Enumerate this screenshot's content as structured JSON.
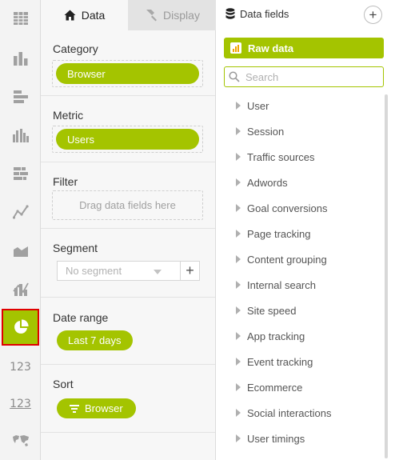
{
  "rail": {
    "items": [
      {
        "name": "table-icon"
      },
      {
        "name": "bar-chart-icon"
      },
      {
        "name": "horizontal-bar-chart-icon"
      },
      {
        "name": "grouped-bar-chart-icon"
      },
      {
        "name": "stacked-bar-chart-icon"
      },
      {
        "name": "line-chart-icon"
      },
      {
        "name": "area-chart-icon"
      },
      {
        "name": "combo-chart-icon"
      },
      {
        "name": "pie-chart-icon",
        "active": true
      },
      {
        "label": "123"
      },
      {
        "label": "123"
      },
      {
        "name": "world-map-icon"
      }
    ]
  },
  "tabs": {
    "data": "Data",
    "display": "Display"
  },
  "config": {
    "category": {
      "label": "Category",
      "value": "Browser"
    },
    "metric": {
      "label": "Metric",
      "value": "Users"
    },
    "filter": {
      "label": "Filter",
      "hint": "Drag data fields here"
    },
    "segment": {
      "label": "Segment",
      "placeholder": "No segment"
    },
    "date_range": {
      "label": "Date range",
      "value": "Last 7 days"
    },
    "sort": {
      "label": "Sort",
      "value": "Browser"
    }
  },
  "fields": {
    "title": "Data fields",
    "raw_data": "Raw data",
    "search_placeholder": "Search",
    "items": [
      "User",
      "Session",
      "Traffic sources",
      "Adwords",
      "Goal conversions",
      "Page tracking",
      "Content grouping",
      "Internal search",
      "Site speed",
      "App tracking",
      "Event tracking",
      "Ecommerce",
      "Social interactions",
      "User timings"
    ]
  },
  "colors": {
    "accent": "#a4c400",
    "highlight": "#e00000"
  }
}
